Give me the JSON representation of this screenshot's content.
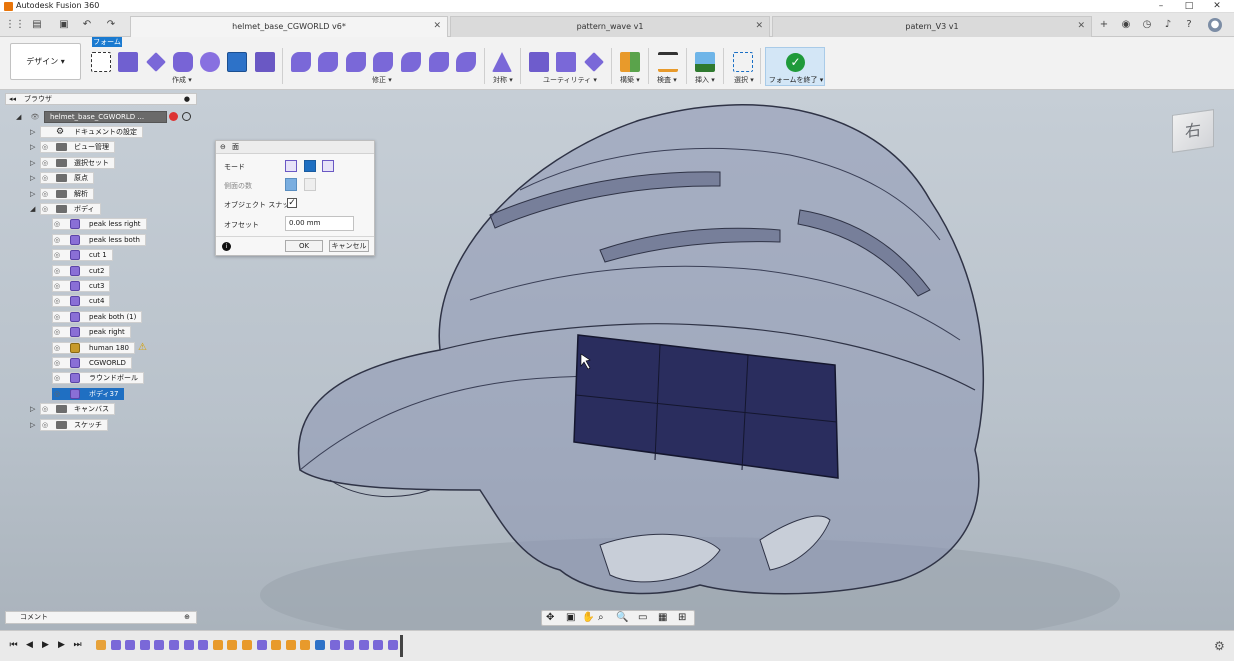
{
  "app": {
    "title": "Autodesk Fusion 360"
  },
  "tabs": [
    {
      "label": "helmet_base_CGWORLD v6*",
      "active": true
    },
    {
      "label": "pattern_wave v1",
      "active": false
    },
    {
      "label": "patern_V3 v1",
      "active": false
    }
  ],
  "ribbon": {
    "design_label": "デザイン ▾",
    "active_tab": "フォーム",
    "groups": [
      {
        "label": "作成 ▾"
      },
      {
        "label": "修正 ▾"
      },
      {
        "label": "対称 ▾"
      },
      {
        "label": "ユーティリティ ▾"
      },
      {
        "label": "構築 ▾"
      },
      {
        "label": "検査 ▾"
      },
      {
        "label": "挿入 ▾"
      },
      {
        "label": "選択 ▾"
      }
    ],
    "finish_label": "フォームを終了 ▾"
  },
  "browser": {
    "title": "ブラウザ",
    "root": "helmet_base_CGWORLD ...",
    "items": [
      {
        "label": "ドキュメントの設定"
      },
      {
        "label": "ビュー管理"
      },
      {
        "label": "選択セット"
      },
      {
        "label": "原点"
      },
      {
        "label": "解析"
      },
      {
        "label": "ボディ"
      }
    ],
    "bodies": [
      {
        "label": "peak less right"
      },
      {
        "label": "peak less both"
      },
      {
        "label": "cut 1"
      },
      {
        "label": "cut2"
      },
      {
        "label": "cut3"
      },
      {
        "label": "cut4"
      },
      {
        "label": "peak both  (1)"
      },
      {
        "label": "peak right"
      },
      {
        "label": "human 180"
      },
      {
        "label": "CGWORLD"
      },
      {
        "label": "ラウンドボール"
      },
      {
        "label": "ボディ37"
      }
    ],
    "after": [
      {
        "label": "キャンバス"
      },
      {
        "label": "スケッチ"
      }
    ]
  },
  "dialog": {
    "title": "面",
    "mode_label": "モード",
    "sides_label": "側面の数",
    "snap_label": "オブジェクト スナップ",
    "snap_checked": true,
    "offset_label": "オフセット",
    "offset_value": "0.00 mm",
    "ok_label": "OK",
    "cancel_label": "キャンセル"
  },
  "comments": {
    "label": "コメント"
  },
  "colors": {
    "accent": "#1f6fc2",
    "finish_green": "#1f9a3a",
    "surface": "#2a2d5e"
  },
  "viewcube": {
    "face": "右"
  }
}
